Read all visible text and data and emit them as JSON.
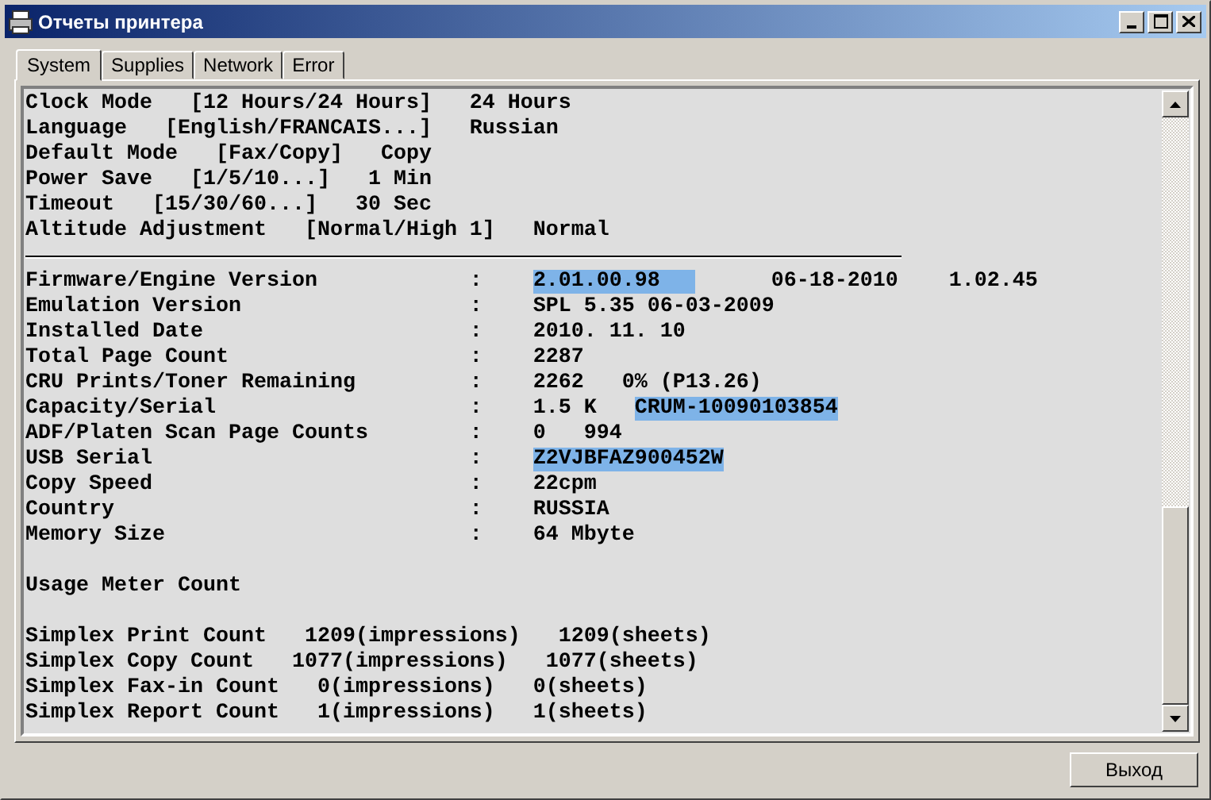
{
  "window": {
    "title": "Отчеты принтера"
  },
  "tabs": [
    {
      "label": "System",
      "selected": true
    },
    {
      "label": "Supplies",
      "selected": false
    },
    {
      "label": "Network",
      "selected": false
    },
    {
      "label": "Error",
      "selected": false
    }
  ],
  "report_lines": [
    {
      "kind": "text",
      "segments": [
        {
          "text": "Clock Mode   [12 Hours/24 Hours]   24 Hours",
          "highlighted": false
        }
      ]
    },
    {
      "kind": "text",
      "segments": [
        {
          "text": "Language   [English/FRANCAIS...]   Russian",
          "highlighted": false
        }
      ]
    },
    {
      "kind": "text",
      "segments": [
        {
          "text": "Default Mode   [Fax/Copy]   Copy",
          "highlighted": false
        }
      ]
    },
    {
      "kind": "text",
      "segments": [
        {
          "text": "Power Save   [1/5/10...]   1 Min",
          "highlighted": false
        }
      ]
    },
    {
      "kind": "text",
      "segments": [
        {
          "text": "Timeout   [15/30/60...]   30 Sec",
          "highlighted": false
        }
      ]
    },
    {
      "kind": "text",
      "segments": [
        {
          "text": "Altitude Adjustment   [Normal/High 1]   Normal",
          "highlighted": false
        }
      ]
    },
    {
      "kind": "rule"
    },
    {
      "kind": "text",
      "segments": [
        {
          "text": "Firmware/Engine Version            :    ",
          "highlighted": false
        },
        {
          "text": "2.01.00.98",
          "highlighted": true
        },
        {
          "text": "      06-18-2010    1.02.45",
          "highlighted": false
        }
      ]
    },
    {
      "kind": "text",
      "segments": [
        {
          "text": "Emulation Version                  :    SPL 5.35 06-03-2009",
          "highlighted": false
        }
      ]
    },
    {
      "kind": "text",
      "segments": [
        {
          "text": "Installed Date                     :    2010. 11. 10",
          "highlighted": false
        }
      ]
    },
    {
      "kind": "text",
      "segments": [
        {
          "text": "Total Page Count                   :    2287",
          "highlighted": false
        }
      ]
    },
    {
      "kind": "text",
      "segments": [
        {
          "text": "CRU Prints/Toner Remaining         :    2262   0% (P13.26)",
          "highlighted": false
        }
      ]
    },
    {
      "kind": "text",
      "segments": [
        {
          "text": "Capacity/Serial                    :    1.5 K   ",
          "highlighted": false
        },
        {
          "text": "CRUM-10090103854",
          "highlighted": true
        }
      ]
    },
    {
      "kind": "text",
      "segments": [
        {
          "text": "ADF/Platen Scan Page Counts        :    0   994",
          "highlighted": false
        }
      ]
    },
    {
      "kind": "text",
      "segments": [
        {
          "text": "USB Serial                         :    ",
          "highlighted": false
        },
        {
          "text": "Z2VJBFAZ900452W",
          "highlighted": true
        }
      ]
    },
    {
      "kind": "text",
      "segments": [
        {
          "text": "Copy Speed                         :    22cpm",
          "highlighted": false
        }
      ]
    },
    {
      "kind": "text",
      "segments": [
        {
          "text": "Country                            :    RUSSIA",
          "highlighted": false
        }
      ]
    },
    {
      "kind": "text",
      "segments": [
        {
          "text": "Memory Size                        :    64 Mbyte",
          "highlighted": false
        }
      ]
    },
    {
      "kind": "blank"
    },
    {
      "kind": "text",
      "segments": [
        {
          "text": "Usage Meter Count",
          "highlighted": false
        }
      ]
    },
    {
      "kind": "blank"
    },
    {
      "kind": "text",
      "segments": [
        {
          "text": "Simplex Print Count   1209(impressions)   1209(sheets)",
          "highlighted": false
        }
      ]
    },
    {
      "kind": "text",
      "segments": [
        {
          "text": "Simplex Copy Count   1077(impressions)   1077(sheets)",
          "highlighted": false
        }
      ]
    },
    {
      "kind": "text",
      "segments": [
        {
          "text": "Simplex Fax-in Count   0(impressions)   0(sheets)",
          "highlighted": false
        }
      ]
    },
    {
      "kind": "text",
      "segments": [
        {
          "text": "Simplex Report Count   1(impressions)   1(sheets)",
          "highlighted": false
        }
      ]
    }
  ],
  "buttons": [
    {
      "label": "Выход"
    }
  ]
}
